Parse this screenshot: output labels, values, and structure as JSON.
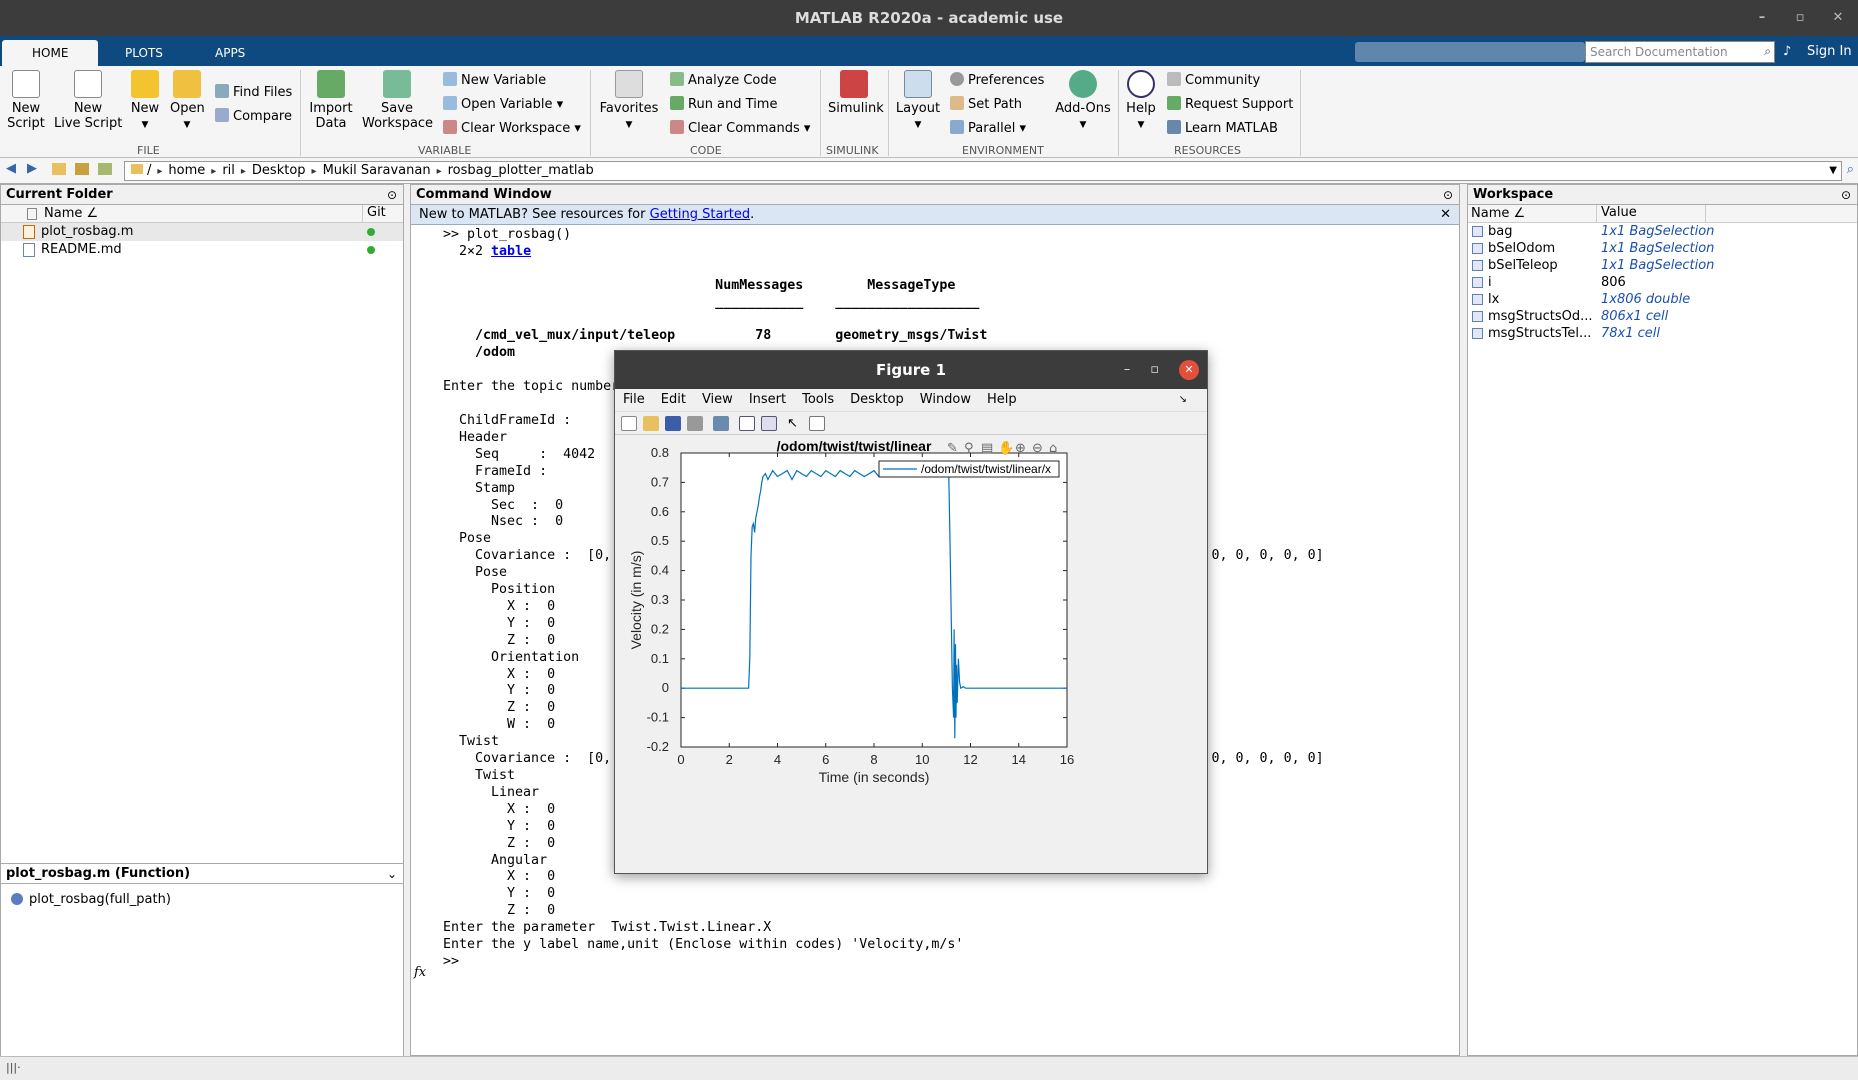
{
  "window": {
    "title": "MATLAB R2020a - academic use",
    "controls": [
      "–",
      "▫",
      "✕"
    ]
  },
  "tabs": [
    "HOME",
    "PLOTS",
    "APPS"
  ],
  "search": {
    "placeholder": "Search Documentation"
  },
  "signin": "Sign In",
  "ribbon": {
    "file": {
      "new_script": "New\nScript",
      "new_live_script": "New\nLive Script",
      "new": "New",
      "open": "Open",
      "find_files": "Find Files",
      "compare": "Compare",
      "group": "FILE"
    },
    "variable": {
      "import_data": "Import\nData",
      "save_workspace": "Save\nWorkspace",
      "new_variable": "New Variable",
      "open_variable": "Open Variable",
      "clear_workspace": "Clear Workspace",
      "group": "VARIABLE"
    },
    "code": {
      "favorites": "Favorites",
      "analyze_code": "Analyze Code",
      "run_and_time": "Run and Time",
      "clear_commands": "Clear Commands",
      "group": "CODE"
    },
    "simulink": {
      "simulink": "Simulink",
      "group": "SIMULINK"
    },
    "environment": {
      "layout": "Layout",
      "preferences": "Preferences",
      "set_path": "Set Path",
      "parallel": "Parallel",
      "addons": "Add-Ons",
      "group": "ENVIRONMENT"
    },
    "resources": {
      "help": "Help",
      "community": "Community",
      "request_support": "Request Support",
      "learn_matlab": "Learn MATLAB",
      "group": "RESOURCES"
    }
  },
  "path": [
    "/",
    "home",
    "ril",
    "Desktop",
    "Mukil Saravanan",
    "rosbag_plotter_matlab"
  ],
  "current_folder": {
    "title": "Current Folder",
    "col_name": "Name ∠",
    "col_git": "Git",
    "files": [
      "plot_rosbag.m",
      "README.md"
    ],
    "details_title": "plot_rosbag.m  (Function)",
    "details_item": "plot_rosbag(full_path)"
  },
  "command_window": {
    "title": "Command Window",
    "info_prefix": "New to MATLAB? See resources for ",
    "info_link": "Getting Started",
    "info_suffix": ".",
    "prompt": ">>",
    "lines": [
      ">> plot_rosbag()",
      "  2×2 table",
      "",
      "                                  NumMessages        MessageType",
      "                                  ___________    __________________",
      "",
      "    /cmd_vel_mux/input/teleop          78        geometry_msgs/Twist",
      "    /odom",
      "",
      "Enter the topic number",
      "",
      "  ChildFrameId :",
      "  Header",
      "    Seq     :  4042",
      "    FrameId :",
      "    Stamp",
      "      Sec  :  0",
      "      Nsec :  0",
      "  Pose",
      "    Covariance :  [0, 0                                                          0, 0, 0, 0, 0, 0, 0, 0, 0, 0]",
      "    Pose",
      "      Position",
      "        X :  0",
      "        Y :  0",
      "        Z :  0",
      "      Orientation",
      "        X :  0",
      "        Y :  0",
      "        Z :  0",
      "        W :  0",
      "  Twist",
      "    Covariance :  [0, 0                                                          0, 0, 0, 0, 0, 0, 0, 0, 0, 0]",
      "    Twist",
      "      Linear",
      "        X :  0",
      "        Y :  0",
      "        Z :  0",
      "      Angular",
      "        X :  0",
      "        Y :  0",
      "        Z :  0",
      "Enter the parameter  Twist.Twist.Linear.X",
      "Enter the y label name,unit (Enclose within codes) 'Velocity,m/s'",
      ">>"
    ]
  },
  "workspace": {
    "title": "Workspace",
    "col_name": "Name ∠",
    "col_value": "Value",
    "vars": [
      {
        "name": "bag",
        "value": "1x1 BagSelection",
        "italic": true
      },
      {
        "name": "bSelOdom",
        "value": "1x1 BagSelection",
        "italic": true
      },
      {
        "name": "bSelTeleop",
        "value": "1x1 BagSelection",
        "italic": true
      },
      {
        "name": "i",
        "value": "806",
        "italic": false
      },
      {
        "name": "lx",
        "value": "1x806 double",
        "italic": true
      },
      {
        "name": "msgStructsOd...",
        "value": "806x1 cell",
        "italic": true
      },
      {
        "name": "msgStructsTel...",
        "value": "78x1 cell",
        "italic": true
      }
    ]
  },
  "figure": {
    "title": "Figure 1",
    "menu": [
      "File",
      "Edit",
      "View",
      "Insert",
      "Tools",
      "Desktop",
      "Window",
      "Help"
    ]
  },
  "chart_data": {
    "type": "line",
    "title": "/odom/twist/twist/linear",
    "xlabel": "Time (in seconds)",
    "ylabel": "Velocity (in m/s)",
    "xlim": [
      0,
      16
    ],
    "ylim": [
      -0.2,
      0.8
    ],
    "xticks": [
      0,
      2,
      4,
      6,
      8,
      10,
      12,
      14,
      16
    ],
    "yticks": [
      -0.2,
      -0.1,
      0,
      0.1,
      0.2,
      0.3,
      0.4,
      0.5,
      0.6,
      0.7,
      0.8
    ],
    "legend": "top-right",
    "grid": false,
    "color": "#0072bd",
    "series": [
      {
        "name": "/odom/twist/twist/linear/x",
        "x": [
          0,
          2.8,
          2.85,
          2.9,
          2.95,
          3.0,
          3.05,
          3.1,
          3.15,
          3.2,
          3.25,
          3.3,
          3.35,
          3.4,
          3.5,
          3.6,
          3.8,
          4.0,
          4.2,
          4.4,
          4.6,
          4.8,
          5.0,
          5.2,
          5.4,
          5.6,
          5.8,
          6.0,
          6.2,
          6.4,
          6.6,
          6.8,
          7.0,
          7.2,
          7.4,
          7.6,
          7.8,
          8.0,
          8.2,
          8.4,
          8.6,
          8.8,
          9.0,
          9.2,
          9.4,
          9.6,
          9.8,
          10.0,
          10.2,
          10.4,
          10.6,
          10.8,
          11.0,
          11.1,
          11.15,
          11.2,
          11.25,
          11.3,
          11.32,
          11.35,
          11.38,
          11.4,
          11.42,
          11.45,
          11.5,
          11.55,
          11.6,
          11.7,
          11.8,
          12.0,
          14.0,
          16.0
        ],
        "y": [
          0,
          0,
          0.1,
          0.45,
          0.55,
          0.56,
          0.53,
          0.58,
          0.6,
          0.62,
          0.65,
          0.67,
          0.7,
          0.72,
          0.73,
          0.71,
          0.74,
          0.72,
          0.73,
          0.74,
          0.71,
          0.74,
          0.73,
          0.72,
          0.74,
          0.73,
          0.72,
          0.74,
          0.73,
          0.72,
          0.74,
          0.73,
          0.72,
          0.74,
          0.73,
          0.72,
          0.73,
          0.74,
          0.72,
          0.73,
          0.74,
          0.72,
          0.73,
          0.74,
          0.72,
          0.73,
          0.74,
          0.73,
          0.72,
          0.74,
          0.73,
          0.72,
          0.73,
          0.72,
          0.5,
          0.25,
          0.0,
          -0.1,
          0.2,
          -0.17,
          0.15,
          -0.1,
          0.08,
          -0.05,
          0.1,
          0.02,
          0.0,
          0.005,
          0.0,
          0.0,
          0.0,
          0.0
        ]
      }
    ]
  }
}
